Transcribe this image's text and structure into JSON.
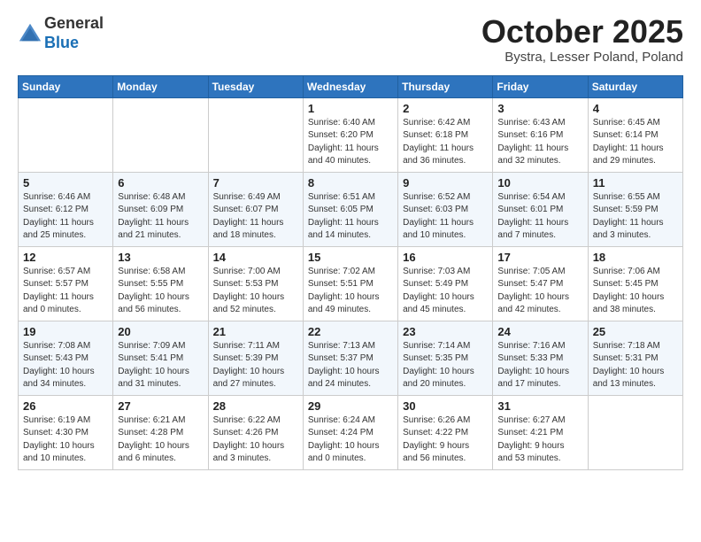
{
  "logo": {
    "general": "General",
    "blue": "Blue"
  },
  "header": {
    "month": "October 2025",
    "location": "Bystra, Lesser Poland, Poland"
  },
  "weekdays": [
    "Sunday",
    "Monday",
    "Tuesday",
    "Wednesday",
    "Thursday",
    "Friday",
    "Saturday"
  ],
  "weeks": [
    [
      {
        "day": "",
        "info": ""
      },
      {
        "day": "",
        "info": ""
      },
      {
        "day": "",
        "info": ""
      },
      {
        "day": "1",
        "info": "Sunrise: 6:40 AM\nSunset: 6:20 PM\nDaylight: 11 hours\nand 40 minutes."
      },
      {
        "day": "2",
        "info": "Sunrise: 6:42 AM\nSunset: 6:18 PM\nDaylight: 11 hours\nand 36 minutes."
      },
      {
        "day": "3",
        "info": "Sunrise: 6:43 AM\nSunset: 6:16 PM\nDaylight: 11 hours\nand 32 minutes."
      },
      {
        "day": "4",
        "info": "Sunrise: 6:45 AM\nSunset: 6:14 PM\nDaylight: 11 hours\nand 29 minutes."
      }
    ],
    [
      {
        "day": "5",
        "info": "Sunrise: 6:46 AM\nSunset: 6:12 PM\nDaylight: 11 hours\nand 25 minutes."
      },
      {
        "day": "6",
        "info": "Sunrise: 6:48 AM\nSunset: 6:09 PM\nDaylight: 11 hours\nand 21 minutes."
      },
      {
        "day": "7",
        "info": "Sunrise: 6:49 AM\nSunset: 6:07 PM\nDaylight: 11 hours\nand 18 minutes."
      },
      {
        "day": "8",
        "info": "Sunrise: 6:51 AM\nSunset: 6:05 PM\nDaylight: 11 hours\nand 14 minutes."
      },
      {
        "day": "9",
        "info": "Sunrise: 6:52 AM\nSunset: 6:03 PM\nDaylight: 11 hours\nand 10 minutes."
      },
      {
        "day": "10",
        "info": "Sunrise: 6:54 AM\nSunset: 6:01 PM\nDaylight: 11 hours\nand 7 minutes."
      },
      {
        "day": "11",
        "info": "Sunrise: 6:55 AM\nSunset: 5:59 PM\nDaylight: 11 hours\nand 3 minutes."
      }
    ],
    [
      {
        "day": "12",
        "info": "Sunrise: 6:57 AM\nSunset: 5:57 PM\nDaylight: 11 hours\nand 0 minutes."
      },
      {
        "day": "13",
        "info": "Sunrise: 6:58 AM\nSunset: 5:55 PM\nDaylight: 10 hours\nand 56 minutes."
      },
      {
        "day": "14",
        "info": "Sunrise: 7:00 AM\nSunset: 5:53 PM\nDaylight: 10 hours\nand 52 minutes."
      },
      {
        "day": "15",
        "info": "Sunrise: 7:02 AM\nSunset: 5:51 PM\nDaylight: 10 hours\nand 49 minutes."
      },
      {
        "day": "16",
        "info": "Sunrise: 7:03 AM\nSunset: 5:49 PM\nDaylight: 10 hours\nand 45 minutes."
      },
      {
        "day": "17",
        "info": "Sunrise: 7:05 AM\nSunset: 5:47 PM\nDaylight: 10 hours\nand 42 minutes."
      },
      {
        "day": "18",
        "info": "Sunrise: 7:06 AM\nSunset: 5:45 PM\nDaylight: 10 hours\nand 38 minutes."
      }
    ],
    [
      {
        "day": "19",
        "info": "Sunrise: 7:08 AM\nSunset: 5:43 PM\nDaylight: 10 hours\nand 34 minutes."
      },
      {
        "day": "20",
        "info": "Sunrise: 7:09 AM\nSunset: 5:41 PM\nDaylight: 10 hours\nand 31 minutes."
      },
      {
        "day": "21",
        "info": "Sunrise: 7:11 AM\nSunset: 5:39 PM\nDaylight: 10 hours\nand 27 minutes."
      },
      {
        "day": "22",
        "info": "Sunrise: 7:13 AM\nSunset: 5:37 PM\nDaylight: 10 hours\nand 24 minutes."
      },
      {
        "day": "23",
        "info": "Sunrise: 7:14 AM\nSunset: 5:35 PM\nDaylight: 10 hours\nand 20 minutes."
      },
      {
        "day": "24",
        "info": "Sunrise: 7:16 AM\nSunset: 5:33 PM\nDaylight: 10 hours\nand 17 minutes."
      },
      {
        "day": "25",
        "info": "Sunrise: 7:18 AM\nSunset: 5:31 PM\nDaylight: 10 hours\nand 13 minutes."
      }
    ],
    [
      {
        "day": "26",
        "info": "Sunrise: 6:19 AM\nSunset: 4:30 PM\nDaylight: 10 hours\nand 10 minutes."
      },
      {
        "day": "27",
        "info": "Sunrise: 6:21 AM\nSunset: 4:28 PM\nDaylight: 10 hours\nand 6 minutes."
      },
      {
        "day": "28",
        "info": "Sunrise: 6:22 AM\nSunset: 4:26 PM\nDaylight: 10 hours\nand 3 minutes."
      },
      {
        "day": "29",
        "info": "Sunrise: 6:24 AM\nSunset: 4:24 PM\nDaylight: 10 hours\nand 0 minutes."
      },
      {
        "day": "30",
        "info": "Sunrise: 6:26 AM\nSunset: 4:22 PM\nDaylight: 9 hours\nand 56 minutes."
      },
      {
        "day": "31",
        "info": "Sunrise: 6:27 AM\nSunset: 4:21 PM\nDaylight: 9 hours\nand 53 minutes."
      },
      {
        "day": "",
        "info": ""
      }
    ]
  ]
}
